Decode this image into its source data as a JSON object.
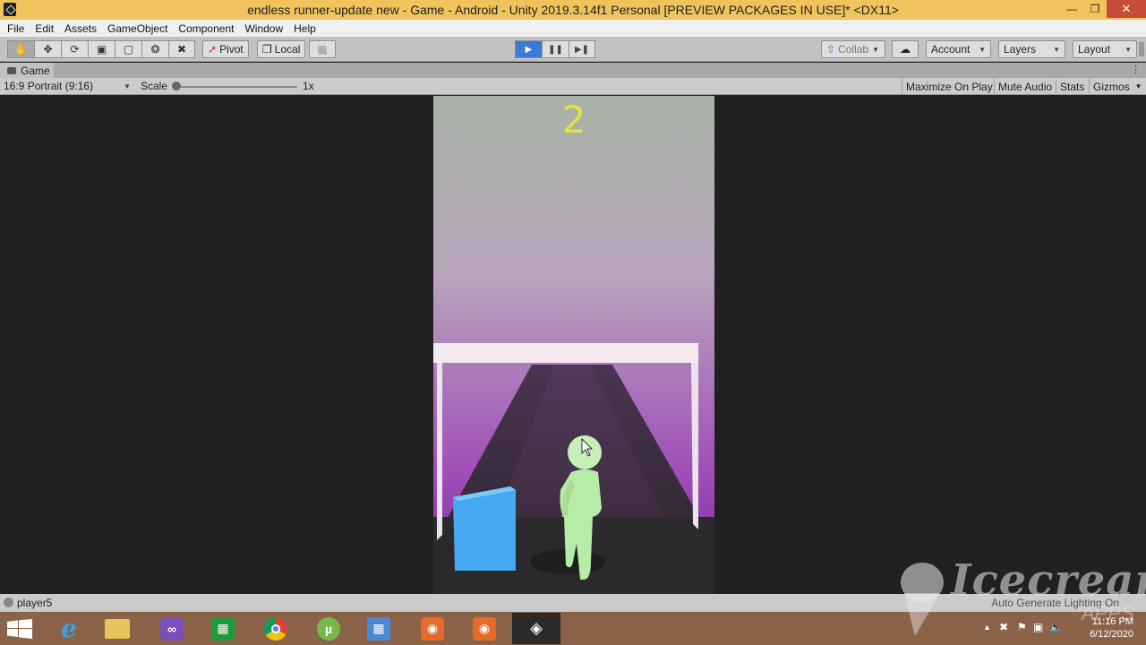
{
  "window": {
    "title": "endless runner-update new - Game - Android - Unity 2019.3.14f1 Personal [PREVIEW PACKAGES IN USE]* <DX11>"
  },
  "menu": [
    "File",
    "Edit",
    "Assets",
    "GameObject",
    "Component",
    "Window",
    "Help"
  ],
  "toolbar": {
    "pivot": "Pivot",
    "local": "Local",
    "collab": "Collab",
    "account": "Account",
    "layers": "Layers",
    "layout": "Layout"
  },
  "game_tab": {
    "label": "Game",
    "resolution": "16:9 Portrait (9:16)",
    "scale_label": "Scale",
    "scale_value": "1x",
    "maximize": "Maximize On Play",
    "mute": "Mute Audio",
    "stats": "Stats",
    "gizmos": "Gizmos"
  },
  "game": {
    "score": "2"
  },
  "status": {
    "text": "player5",
    "right": "Auto Generate Lighting On"
  },
  "taskbar": {
    "time": "11:16 PM",
    "date": "6/12/2020"
  },
  "watermark": {
    "brand": "Icecream",
    "sub": "APPS"
  },
  "colors": {
    "title_bar": "#f0c35c",
    "play_active": "#3b7bd3",
    "score": "#e6e23e",
    "cube": "#46aaf0",
    "player": "#b6eca8",
    "taskbar": "#8a6348"
  }
}
